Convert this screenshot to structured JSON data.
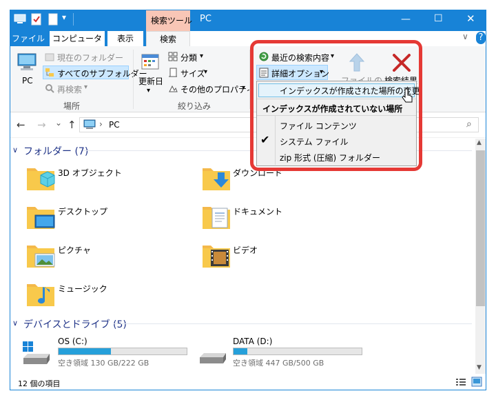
{
  "window": {
    "title": "PC",
    "context_tab_group": "検索ツール",
    "minimize_glyph": "—",
    "maximize_glyph": "☐",
    "close_glyph": "✕"
  },
  "quick_access_glyph": "▾",
  "tabs": [
    "ファイル",
    "コンピューター",
    "表示",
    "検索"
  ],
  "help_glyph": "?",
  "collapse_glyph": "∨",
  "ribbon": {
    "location_group": {
      "pc_label": "PC",
      "current_folder": "現在のフォルダー",
      "all_subfolders": "すべてのサブフォルダー",
      "search_again": "再検索",
      "group_label": "場所"
    },
    "refine_group": {
      "date_modified": "更新日",
      "kind": "分類",
      "size": "サイズ",
      "other_properties": "その他のプロパティ",
      "group_label": "絞り込み"
    },
    "options_group": {
      "recent_searches": "最近の検索内容",
      "advanced_options": "詳細オプション",
      "file_location_partial": "ファイルの",
      "close_search_partial": "検索結果"
    }
  },
  "dropdown": {
    "change_indexed_locations": "インデックスが作成された場所の変更",
    "header": "インデックスが作成されていない場所",
    "items": [
      {
        "label": "ファイル コンテンツ",
        "checked": false
      },
      {
        "label": "システム ファイル",
        "checked": true
      },
      {
        "label": "zip 形式 (圧縮) フォルダー",
        "checked": false
      }
    ],
    "check_glyph": "✔"
  },
  "address": {
    "back": "←",
    "forward": "→",
    "dropdown": "⌄",
    "up": "↑",
    "crumb_sep": "›",
    "location": "PC",
    "refresh": "⟳",
    "search_icon": "⌕"
  },
  "folders_group": {
    "header": "フォルダー (7)",
    "items": [
      "3D オブジェクト",
      "ダウンロード",
      "デスクトップ",
      "ドキュメント",
      "ピクチャ",
      "ビデオ",
      "ミュージック"
    ]
  },
  "drives_group": {
    "header": "デバイスとドライブ (5)",
    "items": [
      {
        "name": "OS (C:)",
        "free": "空き領域 130 GB/222 GB",
        "used_fraction": 0.41
      },
      {
        "name": "DATA (D:)",
        "free": "空き領域 447 GB/500 GB",
        "used_fraction": 0.106
      }
    ]
  },
  "status_bar": {
    "item_count": "12 個の項目"
  },
  "colors": {
    "accent": "#1883d7",
    "context_tab": "#f8c6b6",
    "highlight_border": "#e53935",
    "folder": "#f8c94b",
    "drive_bar": "#26a0da"
  }
}
